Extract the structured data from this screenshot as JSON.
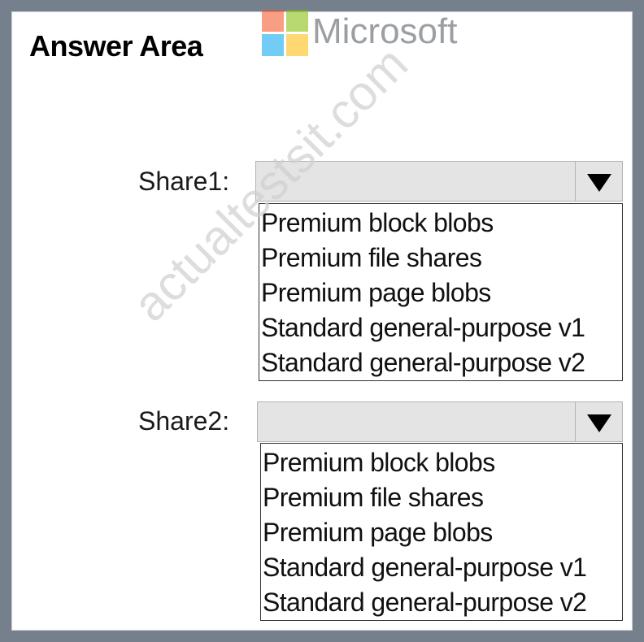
{
  "title": "Answer Area",
  "logo": {
    "text": "Microsoft",
    "colors": [
      "#f25022",
      "#7fba00",
      "#00a4ef",
      "#ffb900"
    ]
  },
  "watermark": "actualtestsit.com",
  "dropdowns": [
    {
      "label": "Share1:",
      "selected": "",
      "options": [
        "Premium block blobs",
        "Premium file shares",
        "Premium page blobs",
        "Standard general-purpose v1",
        "Standard general-purpose v2"
      ]
    },
    {
      "label": "Share2:",
      "selected": "",
      "options": [
        "Premium block blobs",
        "Premium file shares",
        "Premium page blobs",
        "Standard general-purpose v1",
        "Standard general-purpose v2"
      ]
    }
  ]
}
